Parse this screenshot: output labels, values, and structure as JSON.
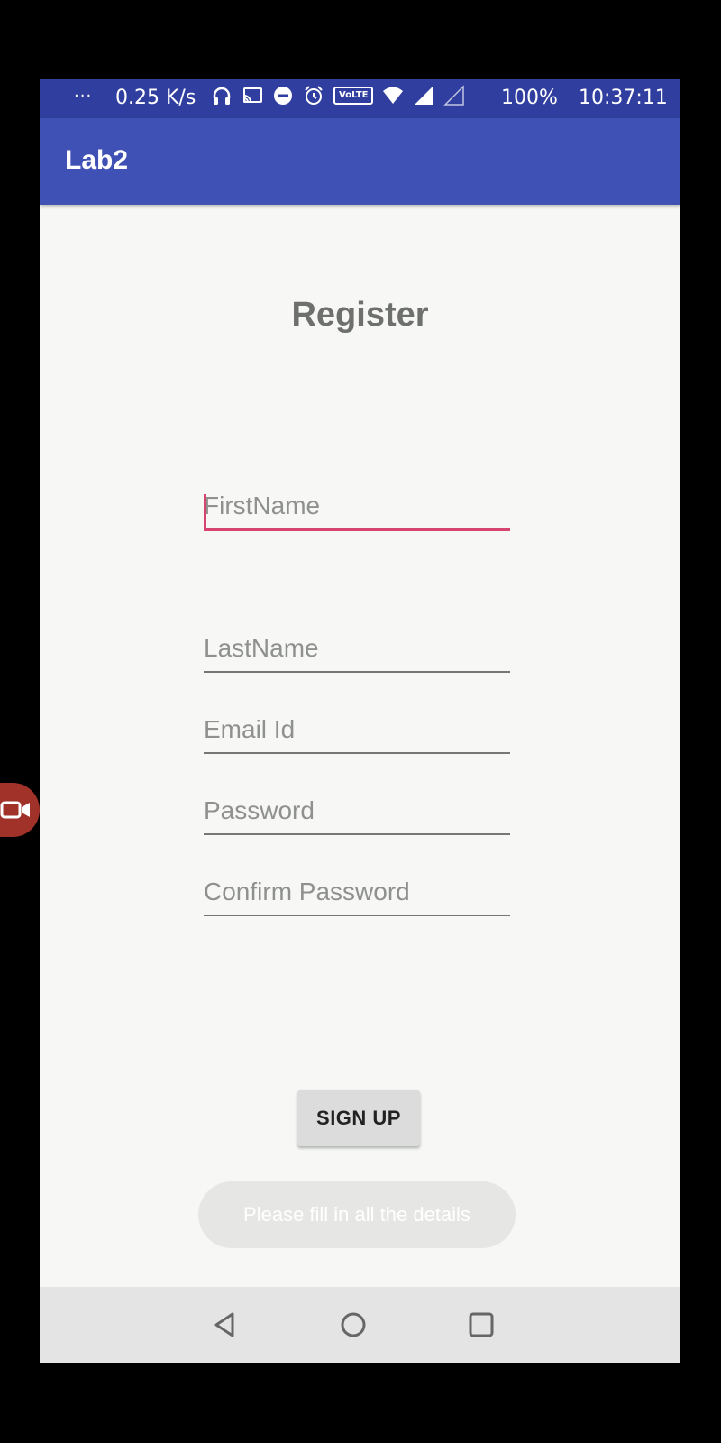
{
  "status_bar": {
    "dots": "···",
    "network_speed": "0.25 K/s",
    "volte_label": "VoLTE",
    "battery": "100%",
    "time": "10:37:11"
  },
  "app_bar": {
    "title": "Lab2"
  },
  "form": {
    "heading": "Register",
    "first_name_placeholder": "FirstName",
    "last_name_placeholder": "LastName",
    "email_placeholder": "Email Id",
    "password_placeholder": "Password",
    "confirm_password_placeholder": "Confirm Password",
    "signup_label": "SIGN UP"
  },
  "toast": {
    "message": "Please fill in all the details"
  },
  "colors": {
    "status_bar": "#303f9f",
    "app_bar": "#3f51b5",
    "accent": "#d6456f",
    "background": "#f7f8f6"
  }
}
